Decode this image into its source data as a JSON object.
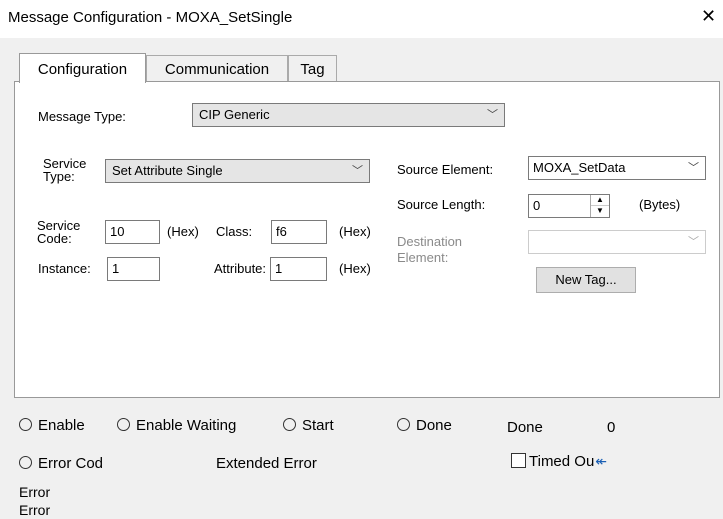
{
  "window": {
    "title": "Message Configuration - MOXA_SetSingle",
    "close_glyph": "✕"
  },
  "tabs": [
    {
      "label": "Configuration",
      "active": true
    },
    {
      "label": "Communication",
      "active": false
    },
    {
      "label": "Tag",
      "active": false
    }
  ],
  "config": {
    "message_type_label": "Message Type:",
    "message_type_value": "CIP Generic",
    "service_type_label_1": "Service",
    "service_type_label_2": "Type:",
    "service_type_value": "Set Attribute Single",
    "service_code_label_1": "Service",
    "service_code_label_2": "Code:",
    "service_code_value": "10",
    "hex_label": "(Hex)",
    "class_label": "Class:",
    "class_value": "f6",
    "instance_label": "Instance:",
    "instance_value": "1",
    "attribute_label": "Attribute:",
    "attribute_value": "1",
    "source_element_label": "Source Element:",
    "source_element_value": "MOXA_SetData",
    "source_length_label": "Source Length:",
    "source_length_value": "0",
    "bytes_label": "(Bytes)",
    "destination_label_1": "Destination",
    "destination_label_2": "Element:",
    "destination_value": "",
    "new_tag_button": "New Tag..."
  },
  "status": {
    "enable": "Enable",
    "enable_waiting": "Enable Waiting",
    "start": "Start",
    "done": "Done",
    "done_label": "Done",
    "done_count": "0",
    "error_code": "Error Cod",
    "extended_error": "Extended Error",
    "timed_out": "Timed Ou",
    "timed_out_checked": false,
    "error_line_1": "Error",
    "error_line_2": "Error"
  }
}
